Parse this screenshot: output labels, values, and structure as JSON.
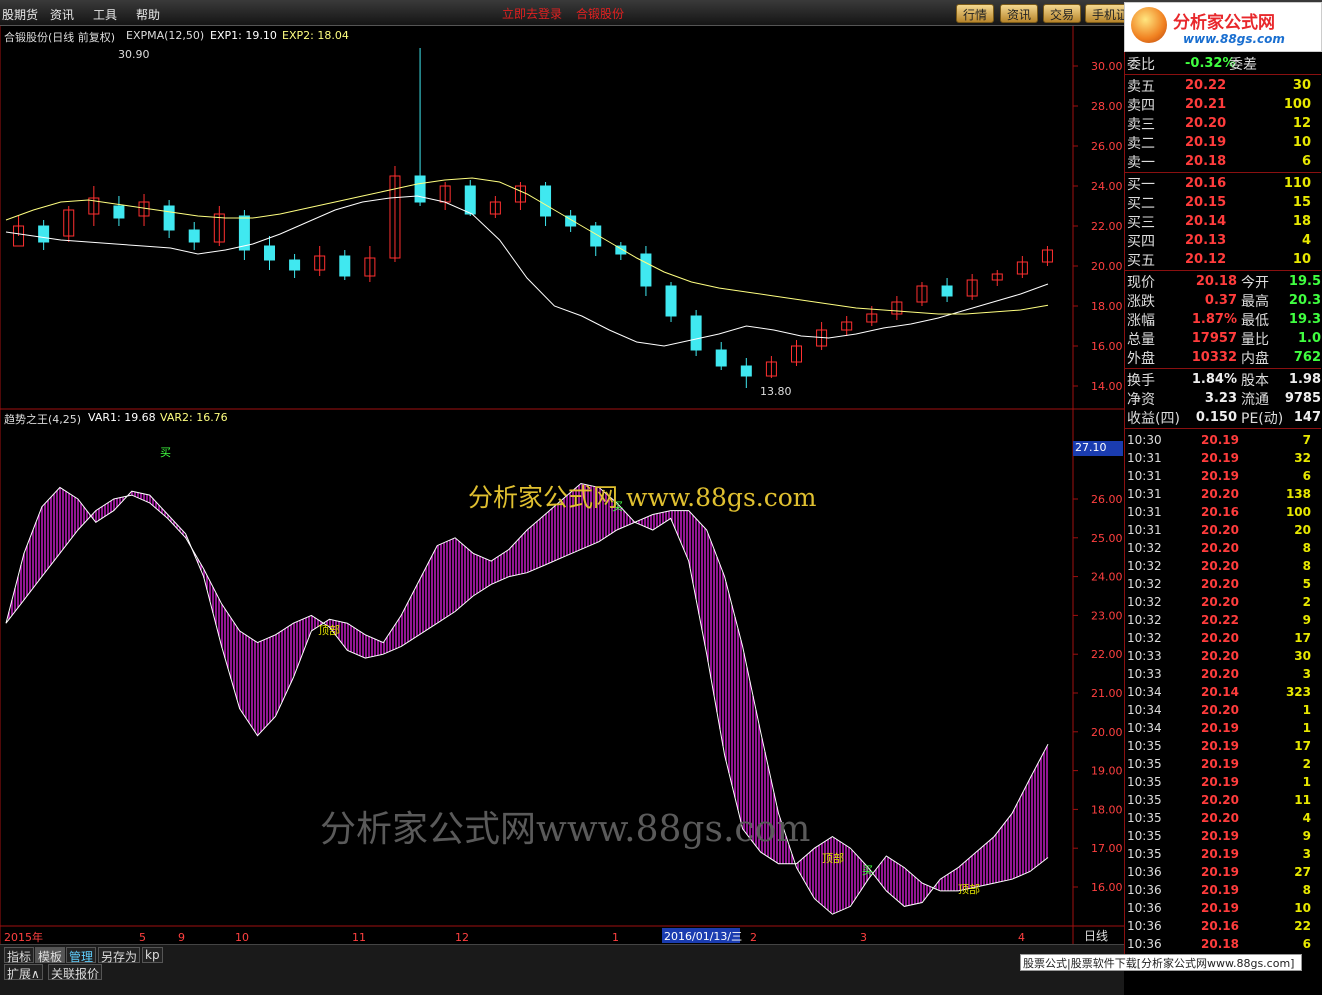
{
  "menu": {
    "items": [
      "股期货",
      "资讯",
      "工具",
      "帮助"
    ],
    "title_left": "立即去登录",
    "title_right": "合锻股份"
  },
  "tabs": [
    "行情",
    "资讯",
    "交易",
    "手机证"
  ],
  "logo": {
    "name": "分析家公式网",
    "url": "www.88gs.com"
  },
  "main_header": {
    "name": "合锻股份(日线 前复权)",
    "indicator": "EXPMA(12,50)",
    "exp1": "EXP1: 19.10",
    "exp2": "EXP2: 18.04",
    "high_label": "30.90",
    "low_label": "13.80"
  },
  "sub_header": {
    "name": "趋势之王(4,25)",
    "var1": "VAR1: 19.68",
    "var2": "VAR2: 16.76",
    "cursor_price": "27.10"
  },
  "main_axis": [
    "30.00",
    "28.00",
    "26.00",
    "24.00",
    "22.00",
    "20.00",
    "18.00",
    "16.00",
    "14.00"
  ],
  "sub_axis": [
    "26.00",
    "25.00",
    "24.00",
    "23.00",
    "22.00",
    "21.00",
    "20.00",
    "19.00",
    "18.00",
    "17.00",
    "16.00"
  ],
  "signals": {
    "buy": "买",
    "top": "顶部"
  },
  "watermark_mid": "分析家公式网 www.88gs.com",
  "watermark_low": "分析家公式网www.88gs.com",
  "x_axis": {
    "year": "2015年",
    "months": [
      "5",
      "9",
      "10",
      "11",
      "12",
      "1",
      "2",
      "3",
      "4"
    ],
    "cursor_date": "2016/01/13/三",
    "period": "日线"
  },
  "quote": {
    "ratio_label": "委比",
    "ratio_value": "-0.32%",
    "diff_label": "委差",
    "asks": [
      {
        "l": "卖五",
        "p": "20.22",
        "v": "30"
      },
      {
        "l": "卖四",
        "p": "20.21",
        "v": "100"
      },
      {
        "l": "卖三",
        "p": "20.20",
        "v": "12"
      },
      {
        "l": "卖二",
        "p": "20.19",
        "v": "10"
      },
      {
        "l": "卖一",
        "p": "20.18",
        "v": "6"
      }
    ],
    "bids": [
      {
        "l": "买一",
        "p": "20.16",
        "v": "110"
      },
      {
        "l": "买二",
        "p": "20.15",
        "v": "15"
      },
      {
        "l": "买三",
        "p": "20.14",
        "v": "18"
      },
      {
        "l": "买四",
        "p": "20.13",
        "v": "4"
      },
      {
        "l": "买五",
        "p": "20.12",
        "v": "10"
      }
    ],
    "stats": [
      {
        "l": "现价",
        "v": "20.18",
        "l2": "今开",
        "v2": "19.5"
      },
      {
        "l": "涨跌",
        "v": "0.37",
        "l2": "最高",
        "v2": "20.3"
      },
      {
        "l": "涨幅",
        "v": "1.87%",
        "l2": "最低",
        "v2": "19.3"
      },
      {
        "l": "总量",
        "v": "17957",
        "l2": "量比",
        "v2": "1.0"
      },
      {
        "l": "外盘",
        "v": "10332",
        "l2": "内盘",
        "v2": "762"
      }
    ],
    "fund": [
      {
        "l": "换手",
        "v": "1.84%",
        "l2": "股本",
        "v2": "1.98"
      },
      {
        "l": "净资",
        "v": "3.23",
        "l2": "流通",
        "v2": "9785"
      },
      {
        "l": "收益(四)",
        "v": "0.150",
        "l2": "PE(动)",
        "v2": "147"
      }
    ]
  },
  "ticks": [
    [
      "10:30",
      "20.19",
      "7"
    ],
    [
      "10:31",
      "20.19",
      "32"
    ],
    [
      "10:31",
      "20.19",
      "6"
    ],
    [
      "10:31",
      "20.20",
      "138"
    ],
    [
      "10:31",
      "20.16",
      "100"
    ],
    [
      "10:31",
      "20.20",
      "20"
    ],
    [
      "10:32",
      "20.20",
      "8"
    ],
    [
      "10:32",
      "20.20",
      "8"
    ],
    [
      "10:32",
      "20.20",
      "5"
    ],
    [
      "10:32",
      "20.20",
      "2"
    ],
    [
      "10:32",
      "20.22",
      "9"
    ],
    [
      "10:32",
      "20.20",
      "17"
    ],
    [
      "10:33",
      "20.20",
      "30"
    ],
    [
      "10:33",
      "20.20",
      "3"
    ],
    [
      "10:34",
      "20.14",
      "323"
    ],
    [
      "10:34",
      "20.20",
      "1"
    ],
    [
      "10:34",
      "20.19",
      "1"
    ],
    [
      "10:35",
      "20.19",
      "17"
    ],
    [
      "10:35",
      "20.19",
      "2"
    ],
    [
      "10:35",
      "20.19",
      "1"
    ],
    [
      "10:35",
      "20.20",
      "11"
    ],
    [
      "10:35",
      "20.20",
      "4"
    ],
    [
      "10:35",
      "20.19",
      "9"
    ],
    [
      "10:35",
      "20.19",
      "3"
    ],
    [
      "10:36",
      "20.19",
      "27"
    ],
    [
      "10:36",
      "20.19",
      "8"
    ],
    [
      "10:36",
      "20.19",
      "10"
    ],
    [
      "10:36",
      "20.16",
      "22"
    ],
    [
      "10:36",
      "20.18",
      "6"
    ]
  ],
  "bottom": {
    "buttons": [
      "指标",
      "模板",
      "管理",
      "另存为",
      "kp"
    ],
    "buttons2": [
      "扩展∧",
      "关联报价"
    ],
    "download": "股票公式|股票软件下载[分析家公式网www.88gs.com]"
  },
  "colors": {
    "up": "#ff3030",
    "down": "#40e8f0",
    "ma_short": "#ffffff",
    "ma_long": "#ffff80",
    "band": "#d020d0"
  },
  "chart_data": {
    "type": "candlestick",
    "ylim": [
      13.5,
      31
    ],
    "candles": [
      [
        21,
        22,
        21.5,
        22.5
      ],
      [
        22,
        21.2,
        20.8,
        22.3
      ],
      [
        21.5,
        22.8,
        21.2,
        23
      ],
      [
        22.6,
        23.4,
        22,
        24
      ],
      [
        23,
        22.4,
        22,
        23.5
      ],
      [
        22.5,
        23.2,
        22,
        23.6
      ],
      [
        23,
        21.8,
        21.4,
        23.3
      ],
      [
        21.8,
        21.2,
        20.8,
        22.2
      ],
      [
        21.2,
        22.6,
        21,
        23
      ],
      [
        22.5,
        20.8,
        20.3,
        22.8
      ],
      [
        21,
        20.3,
        19.8,
        21.5
      ],
      [
        20.3,
        19.8,
        19.4,
        20.6
      ],
      [
        19.8,
        20.5,
        19.5,
        21
      ],
      [
        20.5,
        19.5,
        19.3,
        20.8
      ],
      [
        19.5,
        20.4,
        19.2,
        21
      ],
      [
        20.4,
        24.5,
        20.2,
        25
      ],
      [
        24.5,
        23.2,
        23,
        30.9
      ],
      [
        23.2,
        24,
        22.8,
        24.2
      ],
      [
        24,
        22.6,
        22.5,
        24.3
      ],
      [
        22.6,
        23.2,
        22.4,
        23.5
      ],
      [
        23.2,
        24,
        22.8,
        24.2
      ],
      [
        24,
        22.5,
        22,
        24.2
      ],
      [
        22.5,
        22,
        21.7,
        22.8
      ],
      [
        22,
        21,
        20.5,
        22.2
      ],
      [
        21,
        20.6,
        20.3,
        21.2
      ],
      [
        20.6,
        19,
        18.5,
        21
      ],
      [
        19,
        17.5,
        17.2,
        19.2
      ],
      [
        17.5,
        15.8,
        15.5,
        17.8
      ],
      [
        15.8,
        15,
        14.8,
        16.2
      ],
      [
        15,
        14.5,
        13.9,
        15.4
      ],
      [
        14.5,
        15.2,
        14.4,
        15.5
      ],
      [
        15.2,
        16,
        15,
        16.3
      ],
      [
        16,
        16.8,
        15.8,
        17.2
      ],
      [
        16.8,
        17.2,
        16.5,
        17.5
      ],
      [
        17.2,
        17.6,
        17,
        18
      ],
      [
        17.6,
        18.2,
        17.3,
        18.5
      ],
      [
        18.2,
        19,
        18,
        19.2
      ],
      [
        19,
        18.5,
        18.2,
        19.4
      ],
      [
        18.5,
        19.3,
        18.3,
        19.6
      ],
      [
        19.3,
        19.6,
        19,
        19.8
      ],
      [
        19.6,
        20.2,
        19.4,
        20.5
      ],
      [
        20.2,
        20.8,
        20,
        21
      ]
    ],
    "exp1": [
      21.7,
      21.5,
      21.3,
      21.2,
      21.1,
      21,
      20.9,
      20.6,
      20.8,
      21.1,
      21.6,
      22.2,
      22.8,
      23.2,
      23.4,
      23.5,
      23.2,
      22.6,
      21.3,
      19.4,
      18,
      17.5,
      16.8,
      16.2,
      16,
      16.3,
      16.6,
      17,
      16.8,
      16.5,
      16.4,
      16.6,
      16.9,
      17.1,
      17.4,
      17.8,
      18.2,
      18.6,
      19.1
    ],
    "exp2": [
      22.3,
      22.8,
      23.2,
      23.3,
      23.1,
      22.9,
      22.7,
      22.5,
      22.4,
      22.4,
      22.6,
      22.9,
      23.2,
      23.5,
      23.8,
      24.1,
      24.3,
      24.4,
      24.2,
      23.6,
      22.8,
      22,
      21.2,
      20.4,
      19.7,
      19.2,
      18.9,
      18.7,
      18.5,
      18.3,
      18.1,
      17.9,
      17.8,
      17.7,
      17.6,
      17.6,
      17.7,
      17.8,
      18.04
    ],
    "var1": [
      22.8,
      24.6,
      25.8,
      26.3,
      26.0,
      25.4,
      25.7,
      26.2,
      26.1,
      25.6,
      25.1,
      24.0,
      22.2,
      20.6,
      19.9,
      20.4,
      21.4,
      22.6,
      22.9,
      22.8,
      22.5,
      22.3,
      23.0,
      23.9,
      24.8,
      25.0,
      24.6,
      24.4,
      24.7,
      25.2,
      25.6,
      26.0,
      26.4,
      26.3,
      25.9,
      25.4,
      25.2,
      25.5,
      24.4,
      22.0,
      19.4,
      17.5,
      16.9,
      16.6,
      16.6,
      17.0,
      17.3,
      17.0,
      16.5,
      15.9,
      15.5,
      15.6,
      16.2,
      16.5,
      16.9,
      17.3,
      17.9,
      18.8,
      19.68
    ],
    "var2": [
      22.8,
      23.4,
      24.0,
      24.6,
      25.2,
      25.7,
      26.0,
      26.1,
      25.9,
      25.5,
      25.0,
      24.2,
      23.3,
      22.6,
      22.3,
      22.5,
      22.8,
      23.0,
      22.7,
      22.1,
      21.9,
      22.0,
      22.2,
      22.5,
      22.8,
      23.1,
      23.5,
      23.8,
      24.0,
      24.1,
      24.3,
      24.5,
      24.7,
      24.9,
      25.2,
      25.4,
      25.6,
      25.7,
      25.7,
      25.2,
      24.0,
      22.2,
      20.0,
      17.9,
      16.5,
      15.7,
      15.3,
      15.5,
      16.2,
      16.8,
      16.5,
      16.1,
      15.9,
      15.9,
      16.0,
      16.1,
      16.2,
      16.4,
      16.76
    ]
  }
}
